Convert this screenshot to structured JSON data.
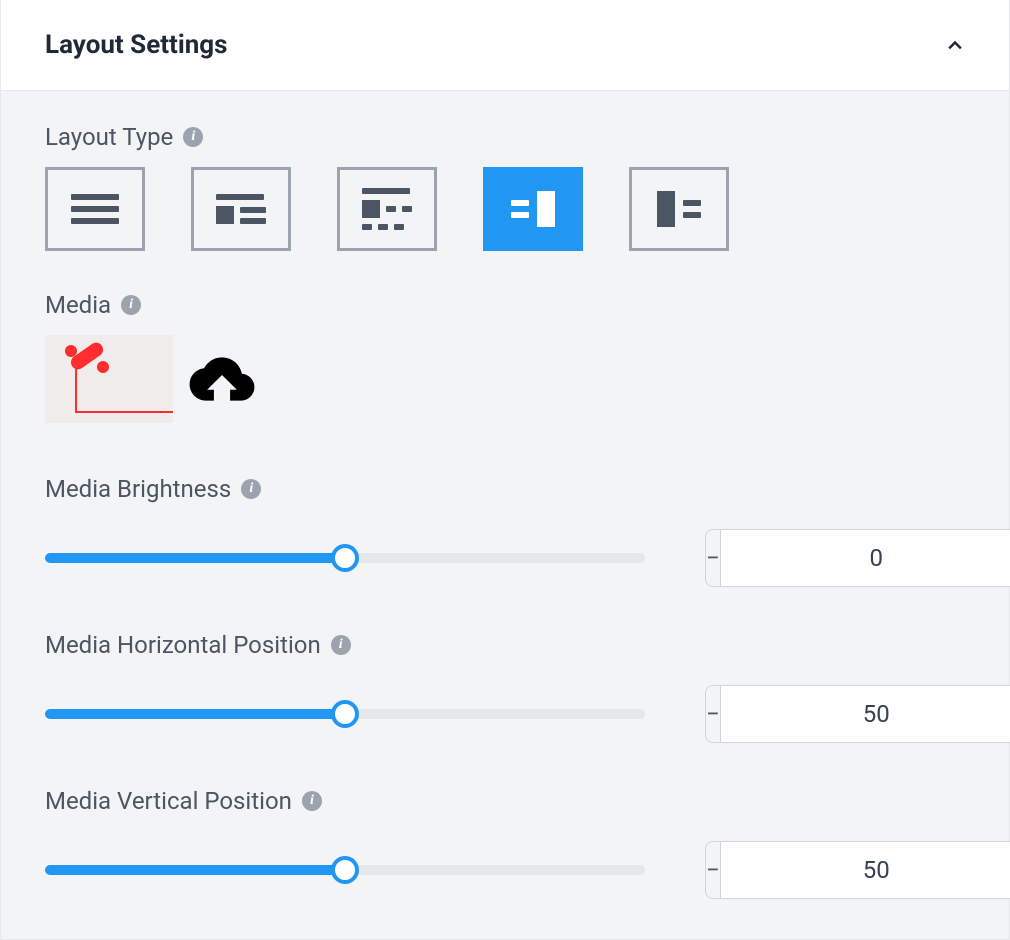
{
  "panel": {
    "title": "Layout Settings"
  },
  "layout_type": {
    "label": "Layout Type",
    "selected_index": 3,
    "options": [
      {
        "name": "text-only"
      },
      {
        "name": "image-left-inline"
      },
      {
        "name": "image-block-text"
      },
      {
        "name": "media-right"
      },
      {
        "name": "media-left"
      }
    ]
  },
  "media": {
    "label": "Media",
    "thumb_alt": "red-telephone-thumbnail"
  },
  "brightness": {
    "label": "Media Brightness",
    "value": 0,
    "min": -100,
    "max": 100,
    "percent": 50
  },
  "hpos": {
    "label": "Media Horizontal Position",
    "value": 50,
    "min": 0,
    "max": 100,
    "percent": 50
  },
  "vpos": {
    "label": "Media Vertical Position",
    "value": 50,
    "min": 0,
    "max": 100,
    "percent": 50
  }
}
